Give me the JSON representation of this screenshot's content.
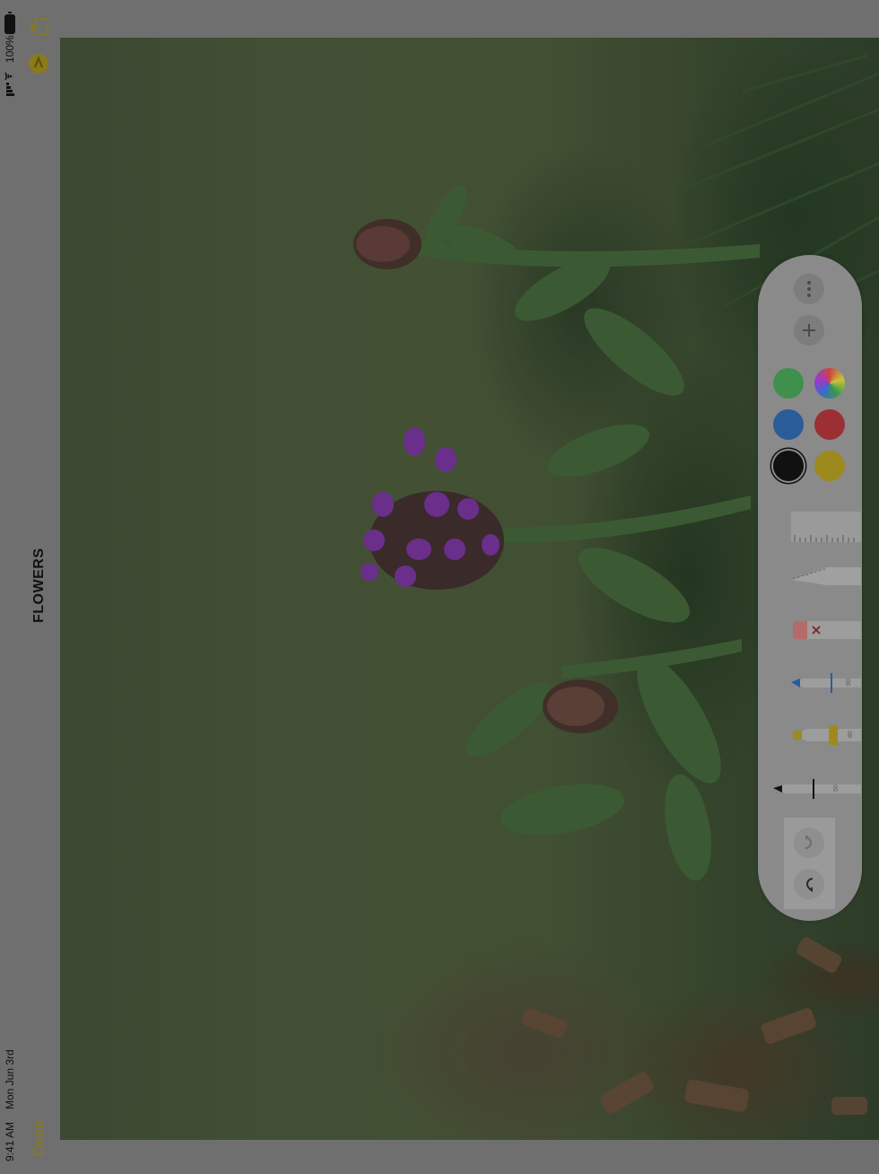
{
  "status_bar": {
    "time": "9:41 AM",
    "date": "Mon Jun 3rd",
    "battery_percent": "100%",
    "icons": [
      "battery-icon",
      "wifi-icon",
      "signal-icon"
    ]
  },
  "toolbar": {
    "share_icon": "share-icon",
    "markup_icon": "markup-icon",
    "done_label": "Done"
  },
  "note": {
    "title": "FLOWERS"
  },
  "palette": {
    "more_icon": "more-icon",
    "add_icon": "plus-icon",
    "colors": [
      {
        "name": "green",
        "hex": "#3f8f4d"
      },
      {
        "name": "multicolor",
        "hex": "conic"
      },
      {
        "name": "blue",
        "hex": "#2a5c99"
      },
      {
        "name": "red",
        "hex": "#9c2f33"
      },
      {
        "name": "black",
        "hex": "#111111",
        "selected": true
      },
      {
        "name": "yellow",
        "hex": "#9c8a1f"
      }
    ],
    "tools": [
      {
        "name": "ruler",
        "label": ""
      },
      {
        "name": "lasso",
        "label": ""
      },
      {
        "name": "eraser",
        "label": ""
      },
      {
        "name": "pen",
        "label": "90"
      },
      {
        "name": "marker",
        "label": "80"
      },
      {
        "name": "pencil",
        "label": "50"
      }
    ],
    "redo_icon": "redo-icon",
    "undo_icon": "undo-icon"
  },
  "accent_color": "#8a7a1a"
}
